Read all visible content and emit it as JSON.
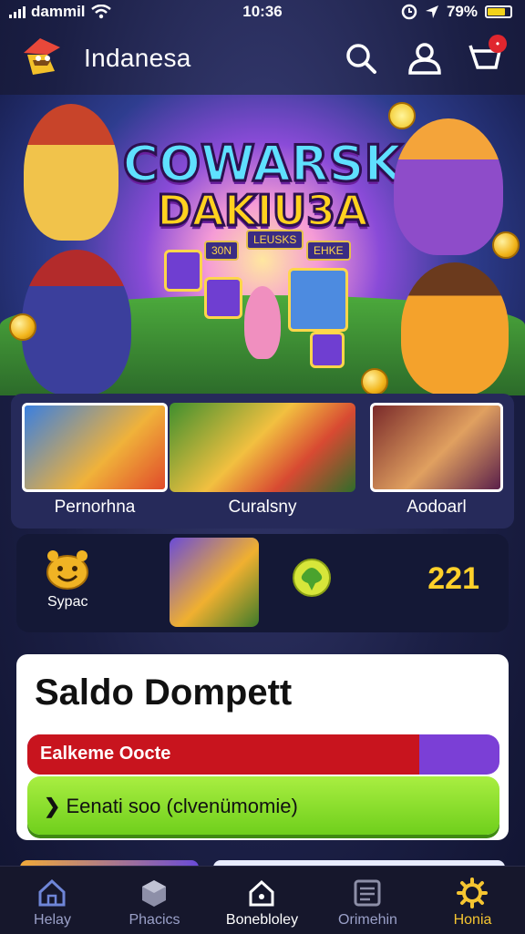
{
  "status_bar": {
    "carrier": "dammil",
    "time": "10:36",
    "battery": "79%"
  },
  "header": {
    "app_title": "Indanesa",
    "icons": [
      "search-icon",
      "user-icon",
      "notification-icon"
    ],
    "notification_badge": "•"
  },
  "hero": {
    "title_line1": "COWARSK",
    "title_line2": "DAKIU3A",
    "tags": [
      "LEUSKS",
      "30N",
      "EHKE"
    ]
  },
  "games": [
    {
      "label": "Pernorhna"
    },
    {
      "label": "Curalsny"
    },
    {
      "label": "Aodoarl"
    }
  ],
  "stats": {
    "left_label": "Sypac",
    "value": "221"
  },
  "wallet": {
    "title": "Saldo Dompett",
    "bar_text": "Ealkeme Oocte",
    "bar_fill_percent": 83,
    "button_text": "Eenati soo (clvenümomie)",
    "colors": {
      "bar_red": "#c8141e",
      "bar_purple": "#7b3fd6",
      "button_green": "#8fe030"
    }
  },
  "nav": {
    "items": [
      {
        "label": "Helay",
        "icon": "home-icon"
      },
      {
        "label": "Phacics",
        "icon": "cube-icon"
      },
      {
        "label": "Bonebloley",
        "icon": "house-outline-icon"
      },
      {
        "label": "Orimehin",
        "icon": "list-icon"
      },
      {
        "label": "Honia",
        "icon": "gear-icon"
      }
    ],
    "active_index": 4,
    "active_color": "#f5c531"
  }
}
